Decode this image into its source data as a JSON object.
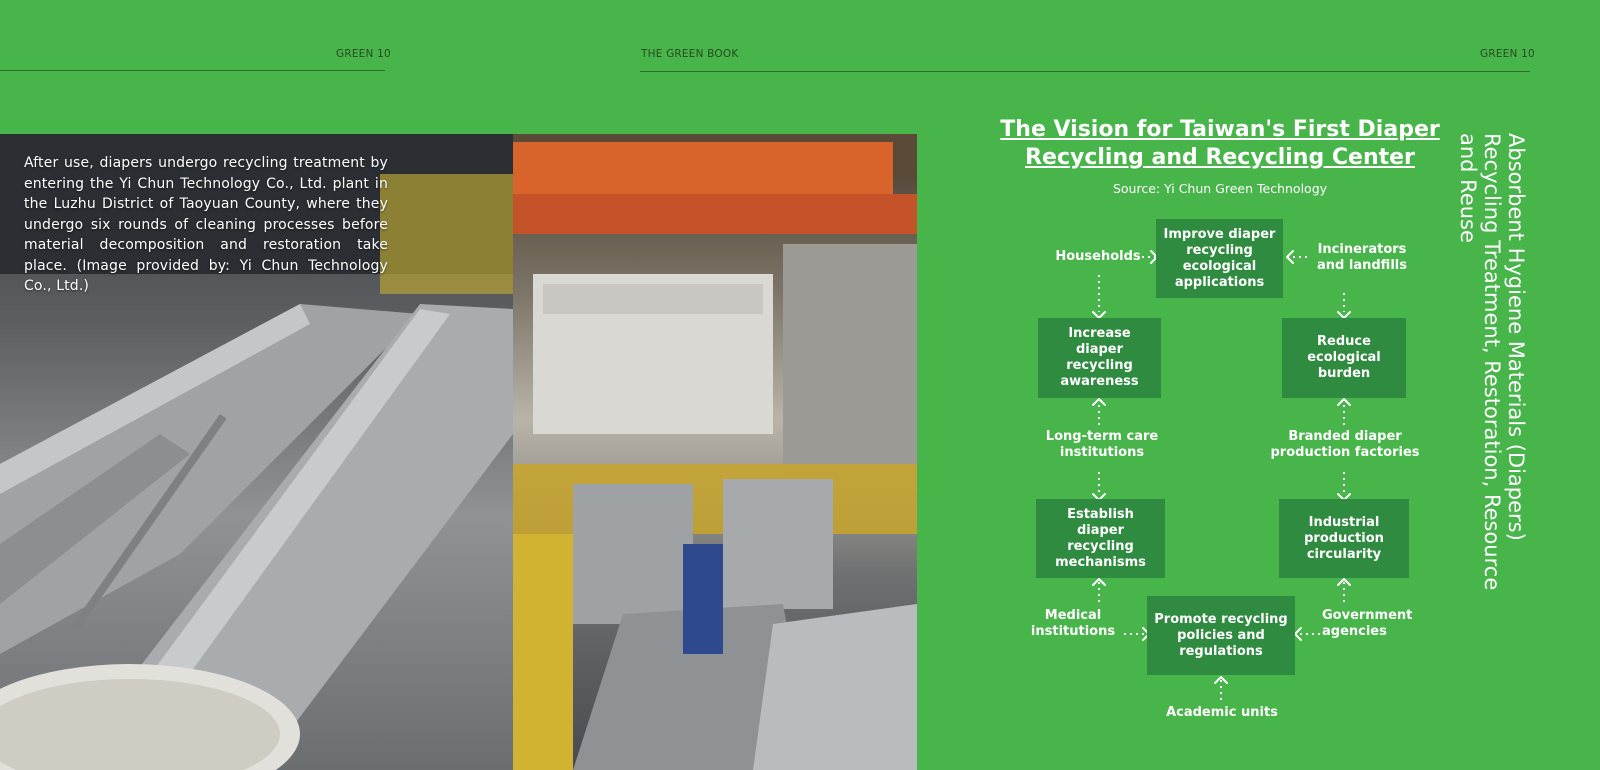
{
  "header": {
    "left_label": "GREEN 10",
    "center_label": "THE GREEN BOOK",
    "right_label": "GREEN 10"
  },
  "photo_caption": "After use, diapers undergo recycling treatment by entering the Yi Chun Technology Co., Ltd. plant in the Luzhu District of Taoyuan County, where they undergo six rounds of cleaning processes before material decomposition and restoration take place. (Image provided by: Yi Chun Technology Co., Ltd.)",
  "diagram": {
    "title": "The Vision for Taiwan's First Diaper Recycling and Recycling Center",
    "source": "Source: Yi Chun Green Technology",
    "boxes": {
      "improve": "Improve diaper recycling ecological applications",
      "awareness": "Increase diaper recycling awareness",
      "reduce": "Reduce ecological burden",
      "establish": "Establish diaper recycling mechanisms",
      "industrial": "Industrial production circularity",
      "promote": "Promote recycling policies and regulations"
    },
    "labels": {
      "households": "Households",
      "incinerators": "Incinerators and landfills",
      "longterm": "Long-term care institutions",
      "branded": "Branded diaper production factories",
      "medical": "Medical institutions",
      "government": "Government agencies",
      "academic": "Academic units"
    },
    "colors": {
      "page": "#47b54a",
      "box": "#2e8b3f",
      "text": "#ffffff"
    }
  },
  "side_heading": "Absorbent Hygiene Materials (Diapers) Recycling Treatment, Restoration, Resource and Reuse"
}
